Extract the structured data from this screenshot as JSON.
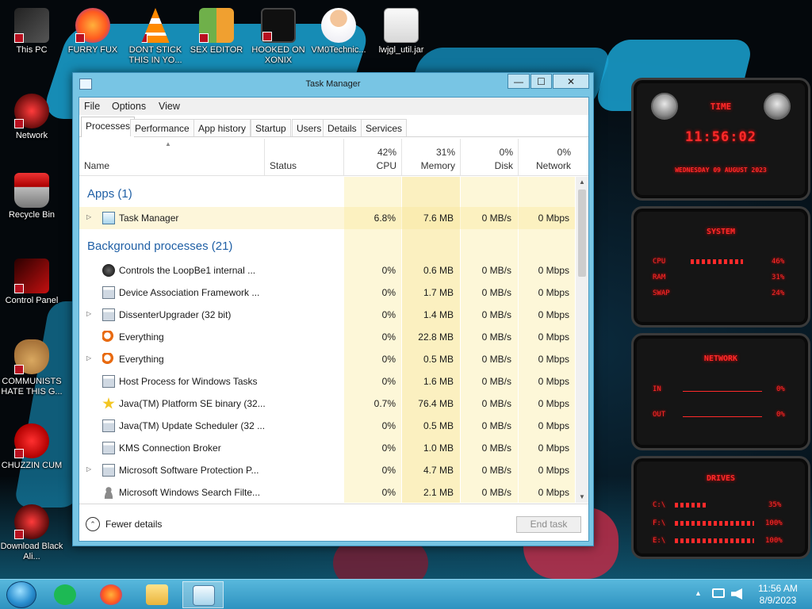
{
  "desktop": {
    "icons": [
      {
        "label": "This PC"
      },
      {
        "label": "FURRY FUX"
      },
      {
        "label": "DONT STICK THIS IN YO..."
      },
      {
        "label": "SEX EDITOR"
      },
      {
        "label": "HOOKED ON XONIX"
      },
      {
        "label": "VM0Technic..."
      },
      {
        "label": "lwjgl_util.jar"
      },
      {
        "label": "Network"
      },
      {
        "label": "Recycle Bin"
      },
      {
        "label": "Control Panel"
      },
      {
        "label": "COMMUNISTS HATE THIS G..."
      },
      {
        "label": "CHUZZIN CUM"
      },
      {
        "label": "Download Black Ali..."
      }
    ]
  },
  "window": {
    "title": "Task Manager",
    "min_glyph": "—",
    "max_glyph": "☐",
    "close_glyph": "✕"
  },
  "menu": {
    "file": "File",
    "options": "Options",
    "view": "View"
  },
  "tabs": [
    "Processes",
    "Performance",
    "App history",
    "Startup",
    "Users",
    "Details",
    "Services"
  ],
  "columns": {
    "name": "Name",
    "status": "Status",
    "cpu": {
      "label": "CPU",
      "percent": "42%"
    },
    "memory": {
      "label": "Memory",
      "percent": "31%"
    },
    "disk": {
      "label": "Disk",
      "percent": "0%"
    },
    "network": {
      "label": "Network",
      "percent": "0%"
    },
    "sort_glyph": "▲"
  },
  "groups": {
    "apps": "Apps (1)",
    "background": "Background processes (21)"
  },
  "processes": [
    {
      "name": "Task Manager",
      "cpu": "6.8%",
      "memory": "7.6 MB",
      "disk": "0 MB/s",
      "network": "0 Mbps",
      "expand": "▷",
      "icon": "task-manager-icon"
    },
    {
      "name": "Controls the LoopBe1 internal ...",
      "cpu": "0%",
      "memory": "0.6 MB",
      "disk": "0 MB/s",
      "network": "0 Mbps",
      "expand": "",
      "icon": "loopbe-icon"
    },
    {
      "name": "Device Association Framework ...",
      "cpu": "0%",
      "memory": "1.7 MB",
      "disk": "0 MB/s",
      "network": "0 Mbps",
      "expand": "",
      "icon": "service-window-icon"
    },
    {
      "name": "DissenterUpgrader (32 bit)",
      "cpu": "0%",
      "memory": "1.4 MB",
      "disk": "0 MB/s",
      "network": "0 Mbps",
      "expand": "▷",
      "icon": "service-window-icon"
    },
    {
      "name": "Everything",
      "cpu": "0%",
      "memory": "22.8 MB",
      "disk": "0 MB/s",
      "network": "0 Mbps",
      "expand": "",
      "icon": "magnifier-icon"
    },
    {
      "name": "Everything",
      "cpu": "0%",
      "memory": "0.5 MB",
      "disk": "0 MB/s",
      "network": "0 Mbps",
      "expand": "▷",
      "icon": "magnifier-icon"
    },
    {
      "name": "Host Process for Windows Tasks",
      "cpu": "0%",
      "memory": "1.6 MB",
      "disk": "0 MB/s",
      "network": "0 Mbps",
      "expand": "",
      "icon": "service-window-icon"
    },
    {
      "name": "Java(TM) Platform SE binary (32...",
      "cpu": "0.7%",
      "memory": "76.4 MB",
      "disk": "0 MB/s",
      "network": "0 Mbps",
      "expand": "",
      "icon": "star-icon"
    },
    {
      "name": "Java(TM) Update Scheduler (32 ...",
      "cpu": "0%",
      "memory": "0.5 MB",
      "disk": "0 MB/s",
      "network": "0 Mbps",
      "expand": "",
      "icon": "service-window-icon"
    },
    {
      "name": "KMS Connection Broker",
      "cpu": "0%",
      "memory": "1.0 MB",
      "disk": "0 MB/s",
      "network": "0 Mbps",
      "expand": "",
      "icon": "service-window-icon"
    },
    {
      "name": "Microsoft Software Protection P...",
      "cpu": "0%",
      "memory": "4.7 MB",
      "disk": "0 MB/s",
      "network": "0 Mbps",
      "expand": "▷",
      "icon": "service-window-icon"
    },
    {
      "name": "Microsoft Windows Search Filte...",
      "cpu": "0%",
      "memory": "2.1 MB",
      "disk": "0 MB/s",
      "network": "0 Mbps",
      "expand": "",
      "icon": "person-icon"
    }
  ],
  "footer": {
    "fewer_details": "Fewer details",
    "fewer_glyph": "⌃",
    "end_task": "End task"
  },
  "gadgets": {
    "time": {
      "heading": "TIME",
      "clock": "11:56:02",
      "date": "WEDNESDAY 09 AUGUST 2023"
    },
    "system": {
      "heading": "SYSTEM",
      "cpu_label": "CPU",
      "cpu_value": "46%",
      "cpu_level": 0.46,
      "ram_label": "RAM",
      "ram_value": "31%",
      "swap_label": "SWAP",
      "swap_value": "24%"
    },
    "network": {
      "heading": "NETWORK",
      "in_label": "IN",
      "in_value": "0%",
      "out_label": "OUT",
      "out_value": "0%"
    },
    "drives": {
      "heading": "DRIVES",
      "c_label": "C:\\",
      "c_value": "35%",
      "f_label": "F:\\",
      "f_value": "100%",
      "e_label": "E:\\",
      "e_value": "100%"
    }
  },
  "taskbar": {
    "clock_time": "11:56 AM",
    "clock_date": "8/9/2023",
    "items": [
      "start-orb",
      "spotify",
      "firefox",
      "file-explorer",
      "task-manager"
    ],
    "tray_up": "▲"
  }
}
